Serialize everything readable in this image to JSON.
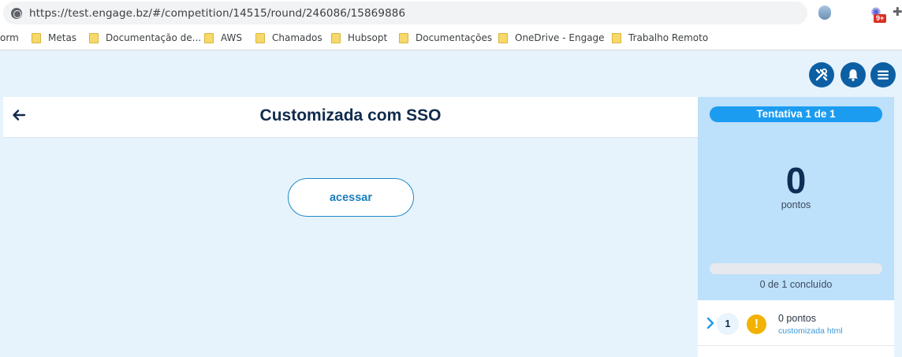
{
  "browser": {
    "url": "https://test.engage.bz/#/competition/14515/round/246086/15869886",
    "extension_badge": "9+"
  },
  "bookmarks": [
    {
      "label": "orm",
      "folder": false
    },
    {
      "label": "Metas",
      "folder": true
    },
    {
      "label": "Documentação de...",
      "folder": true
    },
    {
      "label": "AWS",
      "folder": true
    },
    {
      "label": "Chamados",
      "folder": true
    },
    {
      "label": "Hubsopt",
      "folder": true
    },
    {
      "label": "Documentações",
      "folder": true
    },
    {
      "label": "OneDrive - Engage",
      "folder": true
    },
    {
      "label": "Trabalho Remoto",
      "folder": true
    }
  ],
  "header_buttons": {
    "tools_icon": "tools-icon",
    "bell_icon": "bell-icon",
    "menu_icon": "hamburger-menu-icon"
  },
  "main": {
    "title": "Customizada com SSO",
    "access_button": "acessar"
  },
  "side": {
    "attempt": "Tentativa 1 de 1",
    "score": "0",
    "score_unit": "pontos",
    "progress_fraction": 0,
    "progress_text": "0 de 1 concluído"
  },
  "items": [
    {
      "number": "1",
      "status_icon": "warning-icon",
      "points": "0 pontos",
      "name": "customizada html"
    }
  ],
  "colors": {
    "accent": "#1b9cf0",
    "dark_blue": "#0d5fa3",
    "title": "#102a4c",
    "warning": "#f2b203"
  }
}
